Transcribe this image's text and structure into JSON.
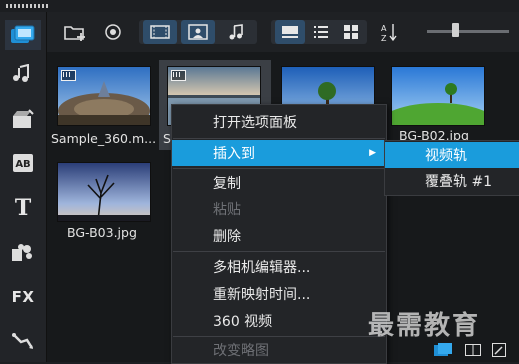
{
  "sidebar": {
    "items": [
      {
        "name": "media-library-icon"
      },
      {
        "name": "audio-library-icon"
      },
      {
        "name": "instant-project-icon"
      },
      {
        "name": "title-ab-icon",
        "glyph": "AB"
      },
      {
        "name": "text-title-icon",
        "glyph": "T"
      },
      {
        "name": "graphics-icon"
      },
      {
        "name": "fx-filter-icon",
        "glyph": "FX"
      },
      {
        "name": "path-motion-icon"
      }
    ]
  },
  "toolbar": {
    "buttons": [
      "add-folder-icon",
      "capture-icon",
      "show-video-icon",
      "show-photo-icon",
      "show-audio-icon",
      "thumbnail-view-icon",
      "list-view-icon",
      "grid-view-icon",
      "sort-icon"
    ]
  },
  "thumbnails": [
    {
      "label": "Sample_360.m...",
      "video": true
    },
    {
      "label": "S",
      "video": true
    },
    {
      "label": "",
      "video": false
    },
    {
      "label": "BG-B02.jpg",
      "video": false
    },
    {
      "label": "BG-B03.jpg",
      "video": false
    }
  ],
  "context_menu": {
    "items": [
      {
        "label": "打开选项面板",
        "state": "normal"
      },
      {
        "label": "插入到",
        "state": "highlighted",
        "has_submenu": true
      },
      {
        "label": "复制",
        "state": "normal"
      },
      {
        "label": "粘贴",
        "state": "disabled"
      },
      {
        "label": "删除",
        "state": "normal"
      },
      {
        "label": "多相机编辑器...",
        "state": "normal"
      },
      {
        "label": "重新映射时间...",
        "state": "normal"
      },
      {
        "label": "360 视频",
        "state": "normal"
      },
      {
        "label": "改变略图",
        "state": "disabled"
      }
    ],
    "submenu_arrow": "▶"
  },
  "submenu": {
    "items": [
      {
        "label": "视频轨",
        "state": "highlighted"
      },
      {
        "label": "覆叠轨 #1",
        "state": "normal"
      }
    ]
  },
  "watermark": "最需教育",
  "colors": {
    "highlight": "#1a9cdc",
    "background": "#17191b",
    "toolbar": "#1f2124"
  }
}
